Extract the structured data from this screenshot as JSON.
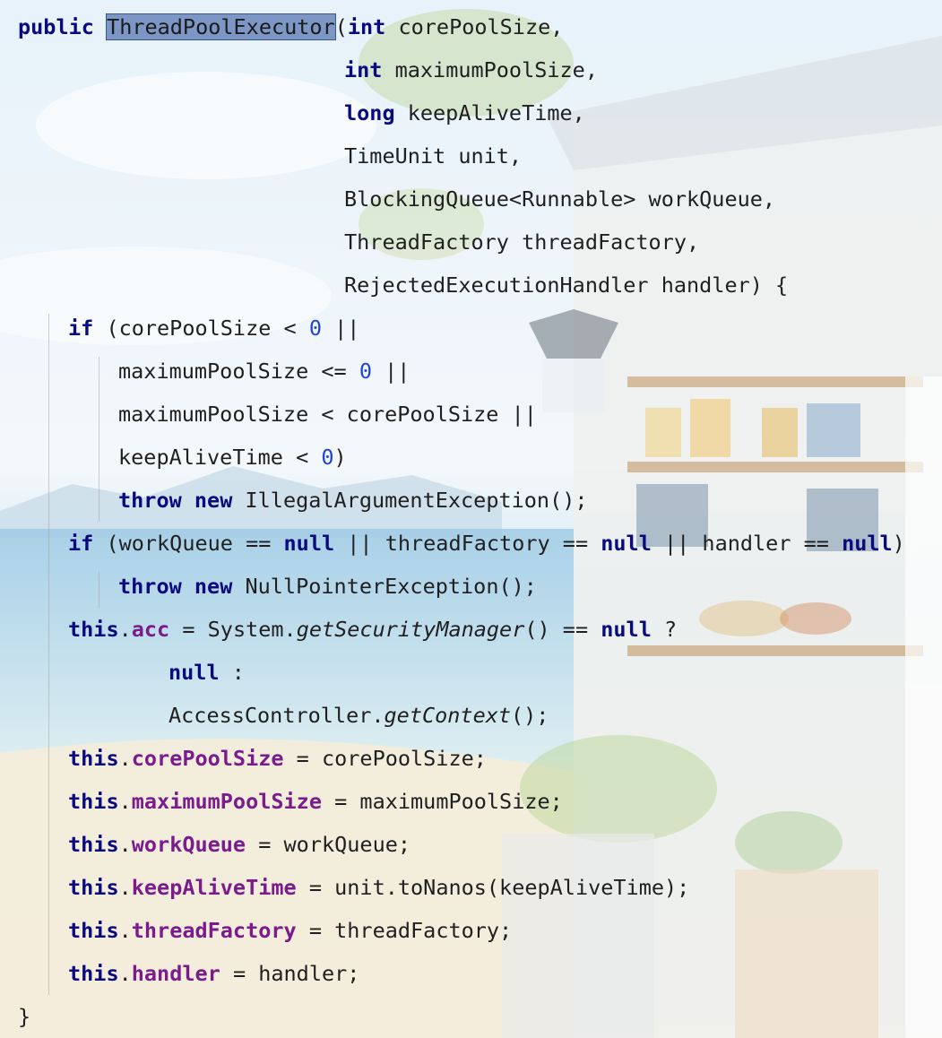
{
  "editor": {
    "code_lines": [
      {
        "indent": 0,
        "tokens": [
          {
            "t": "public",
            "c": "kw"
          },
          {
            "t": " "
          },
          {
            "t": "ThreadPoolExecutor",
            "c": "hl"
          },
          {
            "t": "("
          },
          {
            "t": "int",
            "c": "kw"
          },
          {
            "t": " corePoolSize,"
          }
        ]
      },
      {
        "indent": 26,
        "tokens": [
          {
            "t": "int",
            "c": "kw"
          },
          {
            "t": " maximumPoolSize,"
          }
        ]
      },
      {
        "indent": 26,
        "tokens": [
          {
            "t": "long",
            "c": "kw"
          },
          {
            "t": " keepAliveTime,"
          }
        ]
      },
      {
        "indent": 26,
        "tokens": [
          {
            "t": "TimeUnit unit,"
          }
        ]
      },
      {
        "indent": 26,
        "tokens": [
          {
            "t": "BlockingQueue<Runnable> workQueue,"
          }
        ]
      },
      {
        "indent": 26,
        "tokens": [
          {
            "t": "ThreadFactory threadFactory,"
          }
        ]
      },
      {
        "indent": 26,
        "tokens": [
          {
            "t": "RejectedExecutionHandler handler) {"
          }
        ]
      },
      {
        "indent": 4,
        "tokens": [
          {
            "t": "if",
            "c": "kw"
          },
          {
            "t": " (corePoolSize < "
          },
          {
            "t": "0",
            "c": "num"
          },
          {
            "t": " ||"
          }
        ]
      },
      {
        "indent": 8,
        "tokens": [
          {
            "t": "maximumPoolSize <= "
          },
          {
            "t": "0",
            "c": "num"
          },
          {
            "t": " ||"
          }
        ]
      },
      {
        "indent": 8,
        "tokens": [
          {
            "t": "maximumPoolSize < corePoolSize ||"
          }
        ]
      },
      {
        "indent": 8,
        "tokens": [
          {
            "t": "keepAliveTime < "
          },
          {
            "t": "0",
            "c": "num"
          },
          {
            "t": ")"
          }
        ]
      },
      {
        "indent": 8,
        "tokens": [
          {
            "t": "throw",
            "c": "kw"
          },
          {
            "t": " "
          },
          {
            "t": "new",
            "c": "kw"
          },
          {
            "t": " IllegalArgumentException();"
          }
        ]
      },
      {
        "indent": 4,
        "tokens": [
          {
            "t": "if",
            "c": "kw"
          },
          {
            "t": " (workQueue == "
          },
          {
            "t": "null",
            "c": "kw"
          },
          {
            "t": " || threadFactory == "
          },
          {
            "t": "null",
            "c": "kw"
          },
          {
            "t": " || handler == "
          },
          {
            "t": "null",
            "c": "kw"
          },
          {
            "t": ")"
          }
        ]
      },
      {
        "indent": 8,
        "tokens": [
          {
            "t": "throw",
            "c": "kw"
          },
          {
            "t": " "
          },
          {
            "t": "new",
            "c": "kw"
          },
          {
            "t": " NullPointerException();"
          }
        ]
      },
      {
        "indent": 4,
        "tokens": [
          {
            "t": "this",
            "c": "kw"
          },
          {
            "t": "."
          },
          {
            "t": "acc",
            "c": "fld"
          },
          {
            "t": " = System."
          },
          {
            "t": "getSecurityManager",
            "c": "it"
          },
          {
            "t": "() == "
          },
          {
            "t": "null",
            "c": "kw"
          },
          {
            "t": " ?"
          }
        ]
      },
      {
        "indent": 12,
        "tokens": [
          {
            "t": "null",
            "c": "kw"
          },
          {
            "t": " :"
          }
        ]
      },
      {
        "indent": 12,
        "tokens": [
          {
            "t": "AccessController."
          },
          {
            "t": "getContext",
            "c": "it"
          },
          {
            "t": "();"
          }
        ]
      },
      {
        "indent": 4,
        "tokens": [
          {
            "t": "this",
            "c": "kw"
          },
          {
            "t": "."
          },
          {
            "t": "corePoolSize",
            "c": "fld"
          },
          {
            "t": " = corePoolSize;"
          }
        ]
      },
      {
        "indent": 4,
        "tokens": [
          {
            "t": "this",
            "c": "kw"
          },
          {
            "t": "."
          },
          {
            "t": "maximumPoolSize",
            "c": "fld"
          },
          {
            "t": " = maximumPoolSize;"
          }
        ]
      },
      {
        "indent": 4,
        "tokens": [
          {
            "t": "this",
            "c": "kw"
          },
          {
            "t": "."
          },
          {
            "t": "workQueue",
            "c": "fld"
          },
          {
            "t": " = workQueue;"
          }
        ]
      },
      {
        "indent": 4,
        "tokens": [
          {
            "t": "this",
            "c": "kw"
          },
          {
            "t": "."
          },
          {
            "t": "keepAliveTime",
            "c": "fld"
          },
          {
            "t": " = unit.toNanos(keepAliveTime);"
          }
        ]
      },
      {
        "indent": 4,
        "tokens": [
          {
            "t": "this",
            "c": "kw"
          },
          {
            "t": "."
          },
          {
            "t": "threadFactory",
            "c": "fld"
          },
          {
            "t": " = threadFactory;"
          }
        ]
      },
      {
        "indent": 4,
        "tokens": [
          {
            "t": "this",
            "c": "kw"
          },
          {
            "t": "."
          },
          {
            "t": "handler",
            "c": "fld"
          },
          {
            "t": " = handler;"
          }
        ]
      },
      {
        "indent": 0,
        "tokens": [
          {
            "t": "}"
          }
        ]
      }
    ],
    "colors": {
      "keyword": "#0a0a7f",
      "field": "#7b1b8c",
      "number": "#1f44d9",
      "selection": "#5878b4",
      "text": "#1f1f1f"
    }
  }
}
